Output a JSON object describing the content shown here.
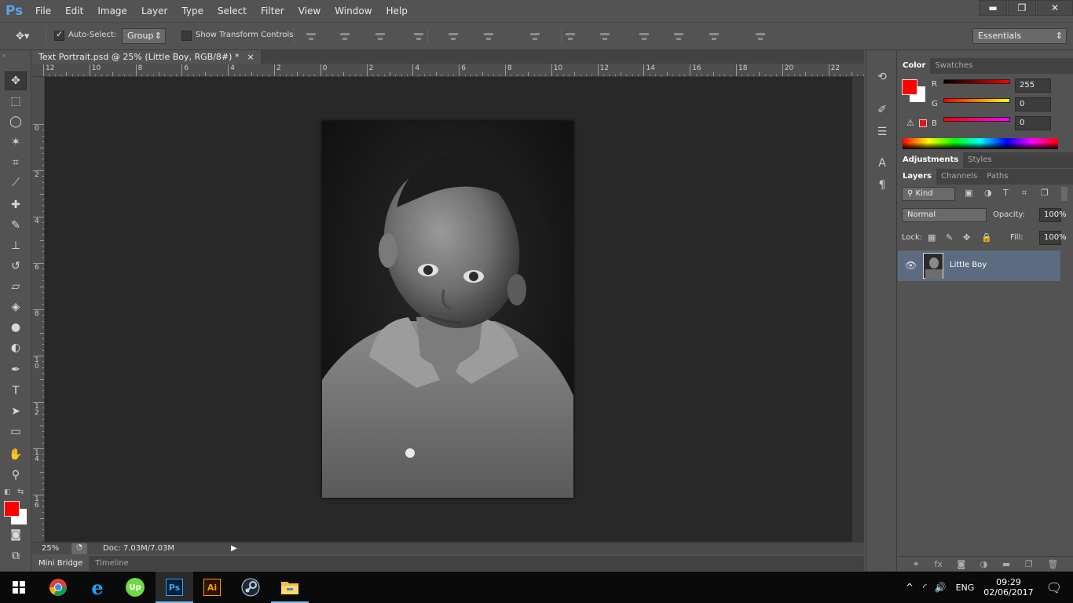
{
  "app": {
    "logo": "Ps"
  },
  "menu": [
    "File",
    "Edit",
    "Image",
    "Layer",
    "Type",
    "Select",
    "Filter",
    "View",
    "Window",
    "Help"
  ],
  "window_controls": {
    "minimize": "▬",
    "restore": "❐",
    "close": "✕"
  },
  "options": {
    "auto_select_label": "Auto-Select:",
    "auto_select_checked": true,
    "group_value": "Group",
    "show_transform_label": "Show Transform Controls",
    "show_transform_checked": false,
    "workspace": "Essentials"
  },
  "document": {
    "tab_title": "Text Portrait.psd @ 25% (Little Boy, RGB/8#) *",
    "close_glyph": "×",
    "zoom": "25%",
    "doc_size": "Doc: 7.03M/7.03M"
  },
  "rulers": {
    "horizontal": [
      "12",
      "10",
      "8",
      "6",
      "4",
      "2",
      "0",
      "2",
      "4",
      "6",
      "8",
      "10",
      "12",
      "14",
      "16",
      "18",
      "20",
      "22"
    ],
    "vertical": [
      "0",
      "2",
      "4",
      "6",
      "8",
      "1\n0",
      "1\n2",
      "1\n4",
      "1\n6"
    ]
  },
  "bottom_tabs": [
    "Mini Bridge",
    "Timeline"
  ],
  "color_panel": {
    "tabs": [
      "Color",
      "Swatches"
    ],
    "foreground": "#ff0000",
    "background": "#ffffff",
    "channels": [
      {
        "label": "R",
        "value": "255"
      },
      {
        "label": "G",
        "value": "0"
      },
      {
        "label": "B",
        "value": "0"
      }
    ]
  },
  "adjustments_tabs": [
    "Adjustments",
    "Styles"
  ],
  "layers_panel": {
    "tabs": [
      "Layers",
      "Channels",
      "Paths"
    ],
    "filter": "Kind",
    "blend_mode": "Normal",
    "opacity_label": "Opacity:",
    "opacity": "100%",
    "lock_label": "Lock:",
    "fill_label": "Fill:",
    "fill": "100%",
    "layers": [
      {
        "name": "Little Boy",
        "visible": true
      }
    ]
  },
  "taskbar": {
    "apps": [
      {
        "name": "chrome",
        "running": false
      },
      {
        "name": "edge",
        "running": false
      },
      {
        "name": "upwork",
        "running": false,
        "label": "Up"
      },
      {
        "name": "photoshop",
        "running": true,
        "label": "Ps"
      },
      {
        "name": "illustrator",
        "running": false,
        "label": "Ai"
      },
      {
        "name": "steam",
        "running": false
      },
      {
        "name": "explorer",
        "running": true
      }
    ],
    "language": "ENG",
    "time": "09:29",
    "date": "02/06/2017"
  }
}
